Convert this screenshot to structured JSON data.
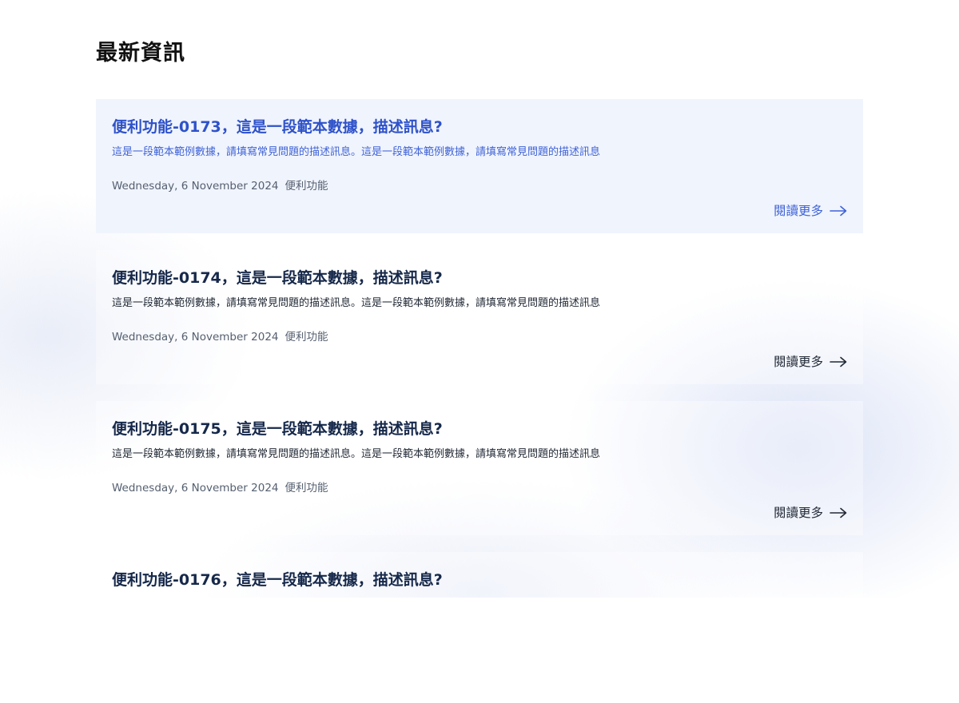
{
  "page": {
    "title": "最新資訊"
  },
  "news": {
    "read_more_label": "閱讀更多",
    "items": [
      {
        "title": "便利功能-0173，這是一段範本數據，描述訊息?",
        "description": "這是一段範本範例數據，請填寫常見問題的描述訊息。這是一段範本範例數據，請填寫常見問題的描述訊息",
        "date": "Wednesday, 6 November 2024",
        "category": "便利功能",
        "read_more": "閱讀更多"
      },
      {
        "title": "便利功能-0174，這是一段範本數據，描述訊息?",
        "description": "這是一段範本範例數據，請填寫常見問題的描述訊息。這是一段範本範例數據，請填寫常見問題的描述訊息",
        "date": "Wednesday, 6 November 2024",
        "category": "便利功能",
        "read_more": "閱讀更多"
      },
      {
        "title": "便利功能-0175，這是一段範本數據，描述訊息?",
        "description": "這是一段範本範例數據，請填寫常見問題的描述訊息。這是一段範本範例數據，請填寫常見問題的描述訊息",
        "date": "Wednesday, 6 November 2024",
        "category": "便利功能",
        "read_more": "閱讀更多"
      },
      {
        "title": "便利功能-0176，這是一段範本數據，描述訊息?",
        "description": "",
        "date": "",
        "category": "",
        "read_more": ""
      }
    ]
  },
  "colors": {
    "accent": "#2e52c9",
    "active_card_bg": "#f0f4fd",
    "title_dark": "#16284a",
    "meta_gray": "#556070"
  },
  "icons": {
    "read_more": "arrow-right-icon"
  }
}
